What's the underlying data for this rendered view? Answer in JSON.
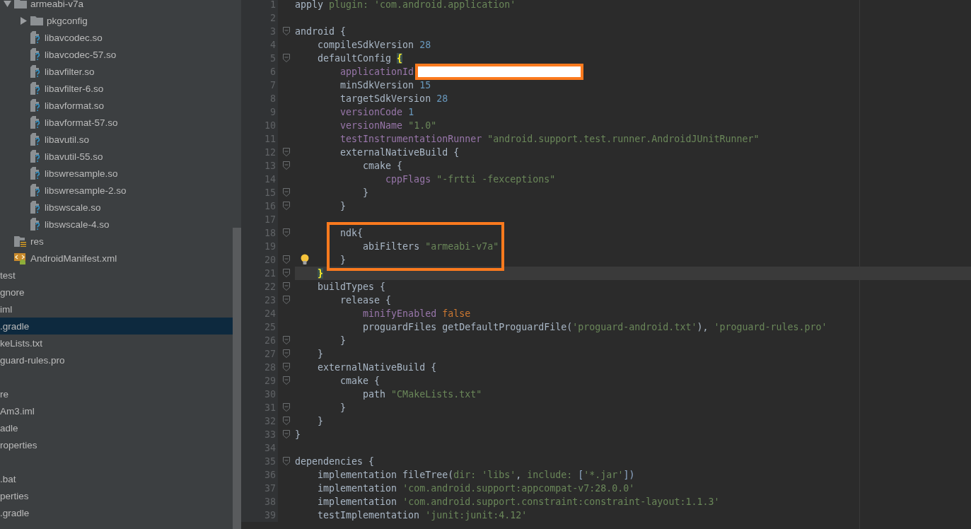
{
  "sidebar": {
    "tree": [
      {
        "label": "armeabi-v7a",
        "kind": "folder",
        "expanded": true,
        "selected": false,
        "children": [
          {
            "label": "pkgconfig",
            "kind": "folder",
            "expanded": false,
            "selected": false
          },
          {
            "label": "libavcodec.so",
            "kind": "unknown_file",
            "selected": false
          },
          {
            "label": "libavcodec-57.so",
            "kind": "unknown_file",
            "selected": false
          },
          {
            "label": "libavfilter.so",
            "kind": "unknown_file",
            "selected": false
          },
          {
            "label": "libavfilter-6.so",
            "kind": "unknown_file",
            "selected": false
          },
          {
            "label": "libavformat.so",
            "kind": "unknown_file",
            "selected": false
          },
          {
            "label": "libavformat-57.so",
            "kind": "unknown_file",
            "selected": false
          },
          {
            "label": "libavutil.so",
            "kind": "unknown_file",
            "selected": false
          },
          {
            "label": "libavutil-55.so",
            "kind": "unknown_file",
            "selected": false
          },
          {
            "label": "libswresample.so",
            "kind": "unknown_file",
            "selected": false
          },
          {
            "label": "libswresample-2.so",
            "kind": "unknown_file",
            "selected": false
          },
          {
            "label": "libswscale.so",
            "kind": "unknown_file",
            "selected": false
          },
          {
            "label": "libswscale-4.so",
            "kind": "unknown_file",
            "selected": false
          }
        ]
      }
    ],
    "items": [
      {
        "label": "res",
        "kind": "res_folder",
        "selected": false
      },
      {
        "label": "AndroidManifest.xml",
        "kind": "manifest",
        "selected": false
      }
    ],
    "clipped_groups": [
      [
        {
          "label": "test",
          "selected": false
        },
        {
          "label": "gnore",
          "selected": false
        },
        {
          "label": "iml",
          "selected": false
        },
        {
          "label": ".gradle",
          "selected": true
        },
        {
          "label": "keLists.txt",
          "selected": false
        },
        {
          "label": "guard-rules.pro",
          "selected": false
        }
      ],
      [
        {
          "label": "re",
          "selected": false
        },
        {
          "label": "Am3.iml",
          "selected": false
        },
        {
          "label": "adle",
          "selected": false
        },
        {
          "label": "roperties",
          "selected": false
        }
      ],
      [
        {
          "label": ".bat",
          "selected": false
        },
        {
          "label": "perties",
          "selected": false
        },
        {
          "label": ".gradle",
          "selected": false
        }
      ]
    ]
  },
  "editor": {
    "lines": [
      {
        "n": "1",
        "tokens": [
          {
            "kind": "plain",
            "text": "apply "
          },
          {
            "kind": "named",
            "text": "plugin: "
          },
          {
            "kind": "str",
            "text": "'com.android.application'"
          }
        ]
      },
      {
        "n": "2"
      },
      {
        "n": "3",
        "fold": true,
        "tokens": [
          {
            "kind": "plain",
            "text": "android {"
          }
        ]
      },
      {
        "n": "4",
        "tokens": [
          {
            "kind": "plain",
            "text": "    compileSdkVersion "
          },
          {
            "kind": "num",
            "text": "28"
          }
        ]
      },
      {
        "n": "5",
        "fold": true,
        "tokens": [
          {
            "kind": "plain",
            "text": "    defaultConfig "
          },
          {
            "kind": "brace_match",
            "text": "{"
          }
        ]
      },
      {
        "n": "6",
        "redacted": true,
        "tokens": [
          {
            "kind": "prop",
            "text": "        applicationId"
          }
        ]
      },
      {
        "n": "7",
        "tokens": [
          {
            "kind": "plain",
            "text": "        minSdkVersion "
          },
          {
            "kind": "num",
            "text": "15"
          }
        ]
      },
      {
        "n": "8",
        "tokens": [
          {
            "kind": "plain",
            "text": "        targetSdkVersion "
          },
          {
            "kind": "num",
            "text": "28"
          }
        ]
      },
      {
        "n": "9",
        "tokens": [
          {
            "kind": "prop",
            "text": "        versionCode "
          },
          {
            "kind": "num",
            "text": "1"
          }
        ]
      },
      {
        "n": "10",
        "tokens": [
          {
            "kind": "prop",
            "text": "        versionName "
          },
          {
            "kind": "str",
            "text": "\"1.0\""
          }
        ]
      },
      {
        "n": "11",
        "tokens": [
          {
            "kind": "prop",
            "text": "        testInstrumentationRunner "
          },
          {
            "kind": "str",
            "text": "\"android.support.test.runner.AndroidJUnitRunner\""
          }
        ]
      },
      {
        "n": "12",
        "fold": true,
        "tokens": [
          {
            "kind": "plain",
            "text": "        externalNativeBuild {"
          }
        ]
      },
      {
        "n": "13",
        "fold": true,
        "tokens": [
          {
            "kind": "plain",
            "text": "            cmake {"
          }
        ]
      },
      {
        "n": "14",
        "tokens": [
          {
            "kind": "prop",
            "text": "                cppFlags "
          },
          {
            "kind": "str",
            "text": "\"-frtti -fexceptions\""
          }
        ]
      },
      {
        "n": "15",
        "fold": true,
        "tokens": [
          {
            "kind": "plain",
            "text": "            }"
          }
        ]
      },
      {
        "n": "16",
        "fold": true,
        "tokens": [
          {
            "kind": "plain",
            "text": "        }"
          }
        ]
      },
      {
        "n": "17"
      },
      {
        "n": "18",
        "fold": true,
        "boxed": true,
        "tokens": [
          {
            "kind": "plain",
            "text": "        ndk{"
          }
        ]
      },
      {
        "n": "19",
        "boxed": true,
        "tokens": [
          {
            "kind": "plain",
            "text": "            abiFilters "
          },
          {
            "kind": "str",
            "text": "\"armeabi-v7a\""
          }
        ]
      },
      {
        "n": "20",
        "fold": true,
        "boxed": true,
        "intention": true,
        "tokens": [
          {
            "kind": "plain",
            "text": "        }"
          }
        ]
      },
      {
        "n": "21",
        "fold": true,
        "current": true,
        "tokens": [
          {
            "kind": "brace_match",
            "text": "    }"
          }
        ]
      },
      {
        "n": "22",
        "fold": true,
        "tokens": [
          {
            "kind": "plain",
            "text": "    buildTypes {"
          }
        ]
      },
      {
        "n": "23",
        "fold": true,
        "tokens": [
          {
            "kind": "plain",
            "text": "        release {"
          }
        ]
      },
      {
        "n": "24",
        "tokens": [
          {
            "kind": "prop",
            "text": "            minifyEnabled "
          },
          {
            "kind": "kw",
            "text": "false"
          }
        ]
      },
      {
        "n": "25",
        "tokens": [
          {
            "kind": "plain",
            "text": "            proguardFiles getDefaultProguardFile("
          },
          {
            "kind": "str",
            "text": "'proguard-android.txt'"
          },
          {
            "kind": "plain",
            "text": "), "
          },
          {
            "kind": "str",
            "text": "'proguard-rules.pro'"
          }
        ]
      },
      {
        "n": "26",
        "fold": true,
        "tokens": [
          {
            "kind": "plain",
            "text": "        }"
          }
        ]
      },
      {
        "n": "27",
        "fold": true,
        "tokens": [
          {
            "kind": "plain",
            "text": "    }"
          }
        ]
      },
      {
        "n": "28",
        "fold": true,
        "tokens": [
          {
            "kind": "plain",
            "text": "    externalNativeBuild {"
          }
        ]
      },
      {
        "n": "29",
        "fold": true,
        "tokens": [
          {
            "kind": "plain",
            "text": "        cmake {"
          }
        ]
      },
      {
        "n": "30",
        "tokens": [
          {
            "kind": "plain",
            "text": "            path "
          },
          {
            "kind": "str",
            "text": "\"CMakeLists.txt\""
          }
        ]
      },
      {
        "n": "31",
        "fold": true,
        "tokens": [
          {
            "kind": "plain",
            "text": "        }"
          }
        ]
      },
      {
        "n": "32",
        "fold": true,
        "tokens": [
          {
            "kind": "plain",
            "text": "    }"
          }
        ]
      },
      {
        "n": "33",
        "fold": true,
        "tokens": [
          {
            "kind": "plain",
            "text": "}"
          }
        ]
      },
      {
        "n": "34"
      },
      {
        "n": "35",
        "fold": true,
        "tokens": [
          {
            "kind": "plain",
            "text": "dependencies {"
          }
        ]
      },
      {
        "n": "36",
        "tokens": [
          {
            "kind": "plain",
            "text": "    implementation fileTree("
          },
          {
            "kind": "named",
            "text": "dir: "
          },
          {
            "kind": "str",
            "text": "'libs'"
          },
          {
            "kind": "plain",
            "text": ", "
          },
          {
            "kind": "named",
            "text": "include: "
          },
          {
            "kind": "bracket",
            "text": "["
          },
          {
            "kind": "str",
            "text": "'*.jar'"
          },
          {
            "kind": "bracket",
            "text": "])"
          }
        ]
      },
      {
        "n": "37",
        "tokens": [
          {
            "kind": "plain",
            "text": "    implementation "
          },
          {
            "kind": "str",
            "text": "'com.android.support:appcompat-v7:28.0.0'"
          }
        ]
      },
      {
        "n": "38",
        "tokens": [
          {
            "kind": "plain",
            "text": "    implementation "
          },
          {
            "kind": "str",
            "text": "'com.android.support.constraint:constraint-layout:1.1.3'"
          }
        ]
      },
      {
        "n": "39",
        "tokens": [
          {
            "kind": "plain",
            "text": "    testImplementation "
          },
          {
            "kind": "str",
            "text": "'junit:junit:4.12'"
          }
        ]
      }
    ]
  }
}
